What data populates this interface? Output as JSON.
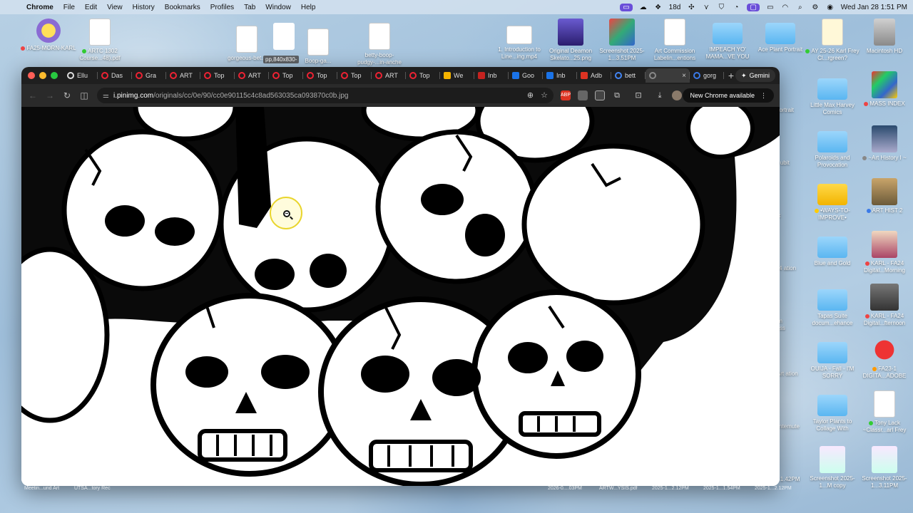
{
  "menubar": {
    "app": "Chrome",
    "menus": [
      "File",
      "Edit",
      "View",
      "History",
      "Bookmarks",
      "Profiles",
      "Tab",
      "Window",
      "Help"
    ],
    "status_badge": "18d",
    "datetime": "Wed Jan 28  1:51 PM"
  },
  "desktop_top": [
    {
      "label": "FA25-MORN-KARL",
      "dot": "#e44"
    },
    {
      "label": "ARTC 1302 Course...48).pdf",
      "dot": "#3c3"
    },
    {
      "label": "gorgeous-bet..."
    },
    {
      "label": "Boop-ga..."
    },
    {
      "label": "betty-boop-pudgy-...in-anche"
    },
    {
      "label": "1. Introduction to Line...ing.mp4"
    },
    {
      "label": "Original Deamon Skelato...25.png"
    },
    {
      "label": "Screenshot 2025-1...3.51PM"
    },
    {
      "label": "Art Commission Labelin...entions"
    },
    {
      "label": "IMPEACH YO' MAMA...VE YOU"
    },
    {
      "label": "Ace Plant Portrait"
    },
    {
      "label": "AY 25-26 Karl Frey Cl...rgreen?",
      "dot": "#3c3"
    },
    {
      "label": "Macintosh HD"
    }
  ],
  "desktop_right": [
    {
      "label": "Little Max Harvey Comics"
    },
    {
      "label": "MASS INDEX",
      "dot": "#e44"
    },
    {
      "label": "Polaroids and Provocation"
    },
    {
      "label": "~Art History I ~",
      "dot": "#888"
    },
    {
      "label": "•WAYS-TO-IMPROVE•",
      "dot": "#fc0"
    },
    {
      "label": "ART HIST 2",
      "dot": "#3a7ae8"
    },
    {
      "label": "Blue and Gold"
    },
    {
      "label": "KARL - FA24 Digital...Morning",
      "dot": "#e44"
    },
    {
      "label": "Tapas Suite docum...ehance"
    },
    {
      "label": "KARL - FA24 Digital...fternoon",
      "dot": "#e44"
    },
    {
      "label": "OUIJA - Fall - I'M SORRY"
    },
    {
      "label": "FA23-1 DIGITA...ADOBE",
      "dot": "#f90"
    },
    {
      "label": "Taylor Plants to Collage With"
    },
    {
      "label": "Tony Lack ~Classr...arl Frey",
      "dot": "#3c3"
    },
    {
      "label": "Screenshot 2025-1...M copy"
    },
    {
      "label": "Screenshot 2025-1...3.11PM"
    }
  ],
  "desktop_partial": [
    "Plant ortrait",
    "ld the ubit",
    "t Duck",
    "a 1954 ation",
    "ndterm Process",
    "Folk Art ation",
    "a rec ntemute",
    "nshot 1.42PM"
  ],
  "dock_labels": [
    "Meetin...und Art",
    "UTSA...tory Rec",
    "2026-0....03PM",
    "ARTW...YSIS.pdf",
    "2025-1...2.12PM",
    "2025-1...1.54PM",
    "2025-1...2.12PM"
  ],
  "tooltip": "pp,840x830-",
  "browser": {
    "tabs": [
      {
        "label": "Ellu",
        "fav": "#ddd"
      },
      {
        "label": "Das",
        "fav": "#e23"
      },
      {
        "label": "Gra",
        "fav": "#e23"
      },
      {
        "label": "ART",
        "fav": "#e23"
      },
      {
        "label": "Top",
        "fav": "#e23"
      },
      {
        "label": "ART",
        "fav": "#e23"
      },
      {
        "label": "Top",
        "fav": "#e23"
      },
      {
        "label": "Top",
        "fav": "#e23"
      },
      {
        "label": "Top",
        "fav": "#e23"
      },
      {
        "label": "ART",
        "fav": "#e23"
      },
      {
        "label": "Top",
        "fav": "#e23"
      },
      {
        "label": "We",
        "fav": "#f5b400"
      },
      {
        "label": "Inb",
        "fav": "#c5221f"
      },
      {
        "label": "Goo",
        "fav": "#1a73e8"
      },
      {
        "label": "Inb",
        "fav": "#1a73e8"
      },
      {
        "label": "Adb",
        "fav": "#d32"
      },
      {
        "label": "bett",
        "fav": "#4285f4"
      }
    ],
    "active_tab": {
      "label": "",
      "close": "×"
    },
    "after_tab": {
      "label": "gorg",
      "fav": "#3a7ae8"
    },
    "new_tab": "+",
    "gemini": "Gemini",
    "url_host": "i.pinimg.com",
    "url_path": "/originals/cc/0e/90/cc0e90115c4c8ad563035ca093870c0b.jpg",
    "update_label": "New Chrome available"
  }
}
